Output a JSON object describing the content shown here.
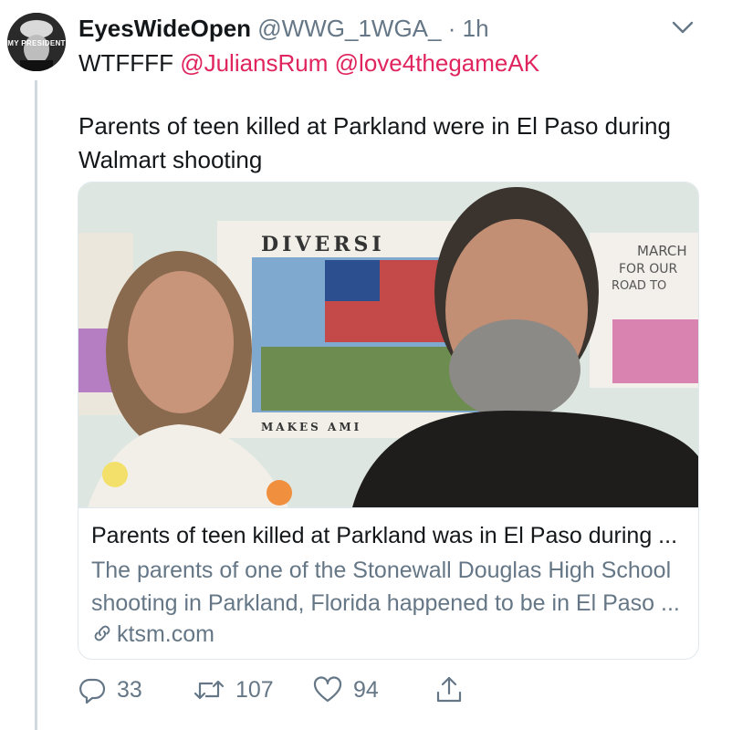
{
  "tweet": {
    "avatar_text": "MY PRESIDENT",
    "display_name": "EyesWideOpen",
    "handle": "@WWG_1WGA_",
    "separator": "·",
    "time": "1h",
    "reply_prefix": "WTFFFF",
    "mentions": [
      "@JuliansRum",
      "@love4thegameAK"
    ],
    "text": "Parents of teen killed at Parkland were in El Paso during Walmart shooting"
  },
  "card": {
    "image_signs": {
      "poster_top": "DIVERSI",
      "poster_bottom": "MAKES AMI",
      "sign_right_1": "MARCH",
      "sign_right_2": "FOR OUR",
      "sign_right_3": "ROAD TO"
    },
    "title": "Parents of teen killed at Parkland was in El Paso during ...",
    "description": "The parents of one of the Stonewall Douglas High School shooting in Parkland, Florida happened to be in El Paso ...",
    "domain": "ktsm.com"
  },
  "actions": {
    "replies": "33",
    "retweets": "107",
    "likes": "94"
  },
  "colors": {
    "accent": "#e0245e",
    "secondary_text": "#657786",
    "border": "#e1e8ed"
  },
  "icons": [
    "chevron-down-icon",
    "link-icon",
    "reply-icon",
    "retweet-icon",
    "like-icon",
    "share-icon"
  ]
}
